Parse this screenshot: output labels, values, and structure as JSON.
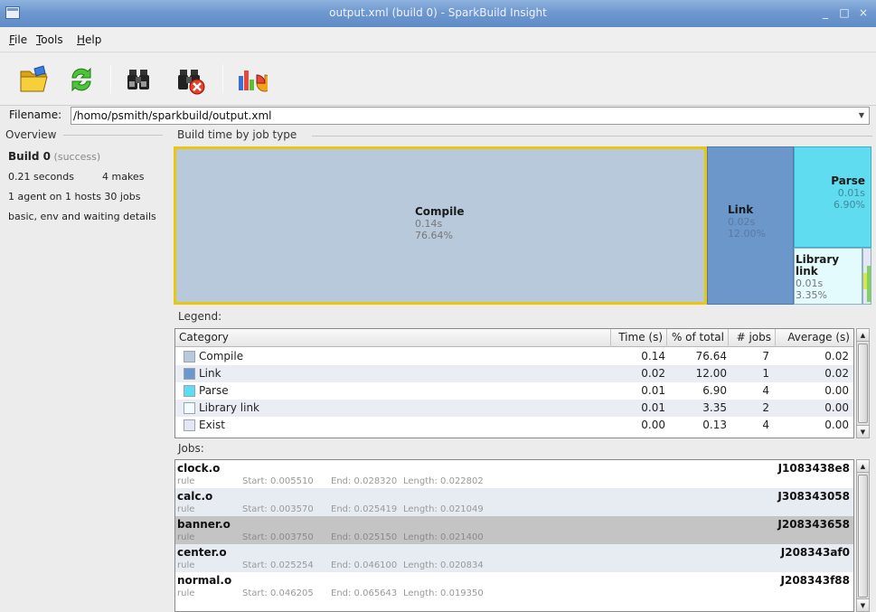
{
  "window": {
    "title": "output.xml (build 0) - SparkBuild Insight",
    "minimize": "_",
    "maximize": "□",
    "close": "×"
  },
  "menu": [
    {
      "label": "File",
      "mnemonic": "F",
      "rest": "ile"
    },
    {
      "label": "Tools",
      "mnemonic": "T",
      "rest": "ools"
    },
    {
      "label": "Help",
      "mnemonic": "H",
      "rest": "elp"
    }
  ],
  "toolbar": {
    "icons": [
      "open-folder-icon",
      "refresh-icon",
      "binoculars-icon",
      "binoculars-clear-icon",
      "chart-icon"
    ]
  },
  "filename": {
    "label": "Filename:",
    "value": "/homo/psmith/sparkbuild/output.xml"
  },
  "overview": {
    "title": "Overview",
    "build": "Build 0",
    "status": "(success)",
    "seconds": "0.21 seconds",
    "makes": "4 makes",
    "agents": "1 agent on 1 hosts  30 jobs",
    "details": "basic, env and waiting details"
  },
  "treemap": {
    "title": "Build time by job type",
    "cells": [
      {
        "name": "Compile",
        "time": "0.14s",
        "pct": "76.64%",
        "color": "#b8c9dc"
      },
      {
        "name": "Link",
        "time": "0.02s",
        "pct": "12.00%",
        "color": "#6b97cb"
      },
      {
        "name": "Parse",
        "time": "0.01s",
        "pct": "6.90%",
        "color": "#5fdcf0"
      },
      {
        "name": "Library link",
        "time": "0.01s",
        "pct": "3.35%",
        "color": "#e3fbfd"
      }
    ],
    "selected_border": "#e8c612"
  },
  "legend": {
    "title": "Legend:",
    "columns": [
      "Category",
      "Time (s)",
      "% of total",
      "# jobs",
      "Average (s)"
    ],
    "rows": [
      {
        "category": "Compile",
        "time": "0.14",
        "pct": "76.64",
        "jobs": "7",
        "avg": "0.02",
        "color": "#b8c9dc"
      },
      {
        "category": "Link",
        "time": "0.02",
        "pct": "12.00",
        "jobs": "1",
        "avg": "0.02",
        "color": "#6b97cb"
      },
      {
        "category": "Parse",
        "time": "0.01",
        "pct": "6.90",
        "jobs": "4",
        "avg": "0.00",
        "color": "#5fdcf0"
      },
      {
        "category": "Library link",
        "time": "0.01",
        "pct": "3.35",
        "jobs": "2",
        "avg": "0.00",
        "color": "#f2fcfe"
      },
      {
        "category": "Exist",
        "time": "0.00",
        "pct": "0.13",
        "jobs": "4",
        "avg": "0.00",
        "color": "#e4e6f4"
      }
    ]
  },
  "jobs": {
    "title": "Jobs:",
    "items": [
      {
        "name": "clock.o",
        "id": "J1083438e8",
        "type": "rule",
        "start": "Start: 0.005510",
        "end": "End: 0.028320",
        "length": "Length: 0.022802"
      },
      {
        "name": "calc.o",
        "id": "J308343058",
        "type": "rule",
        "start": "Start: 0.003570",
        "end": "End: 0.025419",
        "length": "Length: 0.021049"
      },
      {
        "name": "banner.o",
        "id": "J208343658",
        "type": "rule",
        "start": "Start: 0.003750",
        "end": "End: 0.025150",
        "length": "Length: 0.021400"
      },
      {
        "name": "center.o",
        "id": "J208343af0",
        "type": "rule",
        "start": "Start: 0.025254",
        "end": "End: 0.046100",
        "length": "Length: 0.020834"
      },
      {
        "name": "normal.o",
        "id": "J208343f88",
        "type": "rule",
        "start": "Start: 0.046205",
        "end": "End: 0.065643",
        "length": "Length: 0.019350"
      }
    ]
  }
}
